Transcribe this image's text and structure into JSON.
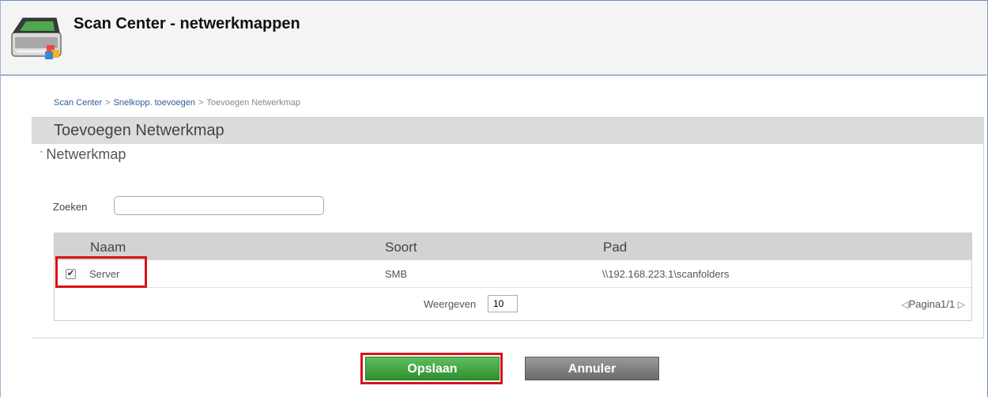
{
  "header": {
    "title": "Scan Center - netwerkmappen",
    "icon": "scanner-icon"
  },
  "breadcrumb": {
    "items": [
      "Scan Center",
      "Snelkopp. toevoegen",
      "Toevoegen Netwerkmap"
    ],
    "separator": ">"
  },
  "panel": {
    "title": "Toevoegen Netwerkmap",
    "section_title": "Netwerkmap",
    "search": {
      "label": "Zoeken",
      "value": "",
      "placeholder": ""
    },
    "table": {
      "columns": [
        "Naam",
        "Soort",
        "Pad"
      ],
      "rows": [
        {
          "checked": true,
          "name": "Server",
          "type": "SMB",
          "path": "\\\\192.168.223.1\\scanfolders"
        }
      ],
      "show_label": "Weergeven",
      "show_value": "10",
      "pager": "Pagina1/1"
    }
  },
  "buttons": {
    "save": "Opslaan",
    "cancel": "Annuler"
  },
  "colors": {
    "save_button": "#3a9f3a",
    "cancel_button": "#7a7a7a",
    "highlight": "#d9121a"
  }
}
